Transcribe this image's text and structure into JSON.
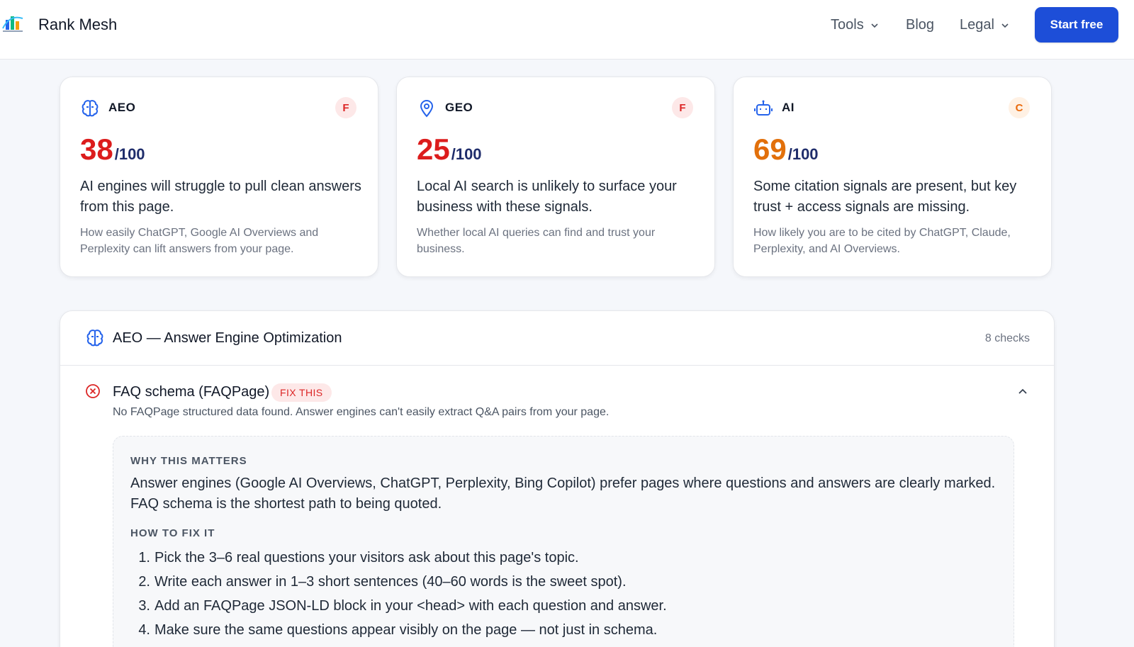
{
  "header": {
    "brand": "Rank Mesh",
    "nav": {
      "tools": "Tools",
      "blog": "Blog",
      "legal": "Legal"
    },
    "cta": "Start free"
  },
  "cards": [
    {
      "label": "AEO",
      "grade": "F",
      "score": "38",
      "out_of": "/100",
      "desc": "AI engines will struggle to pull clean answers from this page.",
      "sub": "How easily ChatGPT, Google AI Overviews and Perplexity can lift answers from your page.",
      "icon": "brain-icon",
      "color": "#dc1c1c"
    },
    {
      "label": "GEO",
      "grade": "F",
      "score": "25",
      "out_of": "/100",
      "desc": "Local AI search is unlikely to surface your business with these signals.",
      "sub": "Whether local AI queries can find and trust your business.",
      "icon": "map-pin-icon",
      "color": "#dc1c1c"
    },
    {
      "label": "AI",
      "grade": "C",
      "score": "69",
      "out_of": "/100",
      "desc": "Some citation signals are present, but key trust + access signals are missing.",
      "sub": "How likely you are to be cited by ChatGPT, Claude, Perplexity, and AI Overviews.",
      "icon": "robot-icon",
      "color": "#e2700b"
    }
  ],
  "section": {
    "title": "AEO — Answer Engine Optimization",
    "checks": "8 checks",
    "check": {
      "title": "FAQ schema (FAQPage)",
      "badge": "FIX THIS",
      "message": "No FAQPage structured data found. Answer engines can't easily extract Q&A pairs from your page.",
      "why_heading": "WHY THIS MATTERS",
      "why_text": "Answer engines (Google AI Overviews, ChatGPT, Perplexity, Bing Copilot) prefer pages where questions and answers are clearly marked. FAQ schema is the shortest path to being quoted.",
      "fix_heading": "HOW TO FIX IT",
      "steps": [
        "Pick the 3–6 real questions your visitors ask about this page's topic.",
        "Write each answer in 1–3 short sentences (40–60 words is the sweet spot).",
        "Add an FAQPage JSON-LD block in your <head> with each question and answer.",
        "Make sure the same questions appear visibly on the page — not just in schema."
      ]
    }
  },
  "colors": {
    "accent": "#1d4ed8",
    "fail": "#dc2626",
    "warn": "#e2700b"
  }
}
